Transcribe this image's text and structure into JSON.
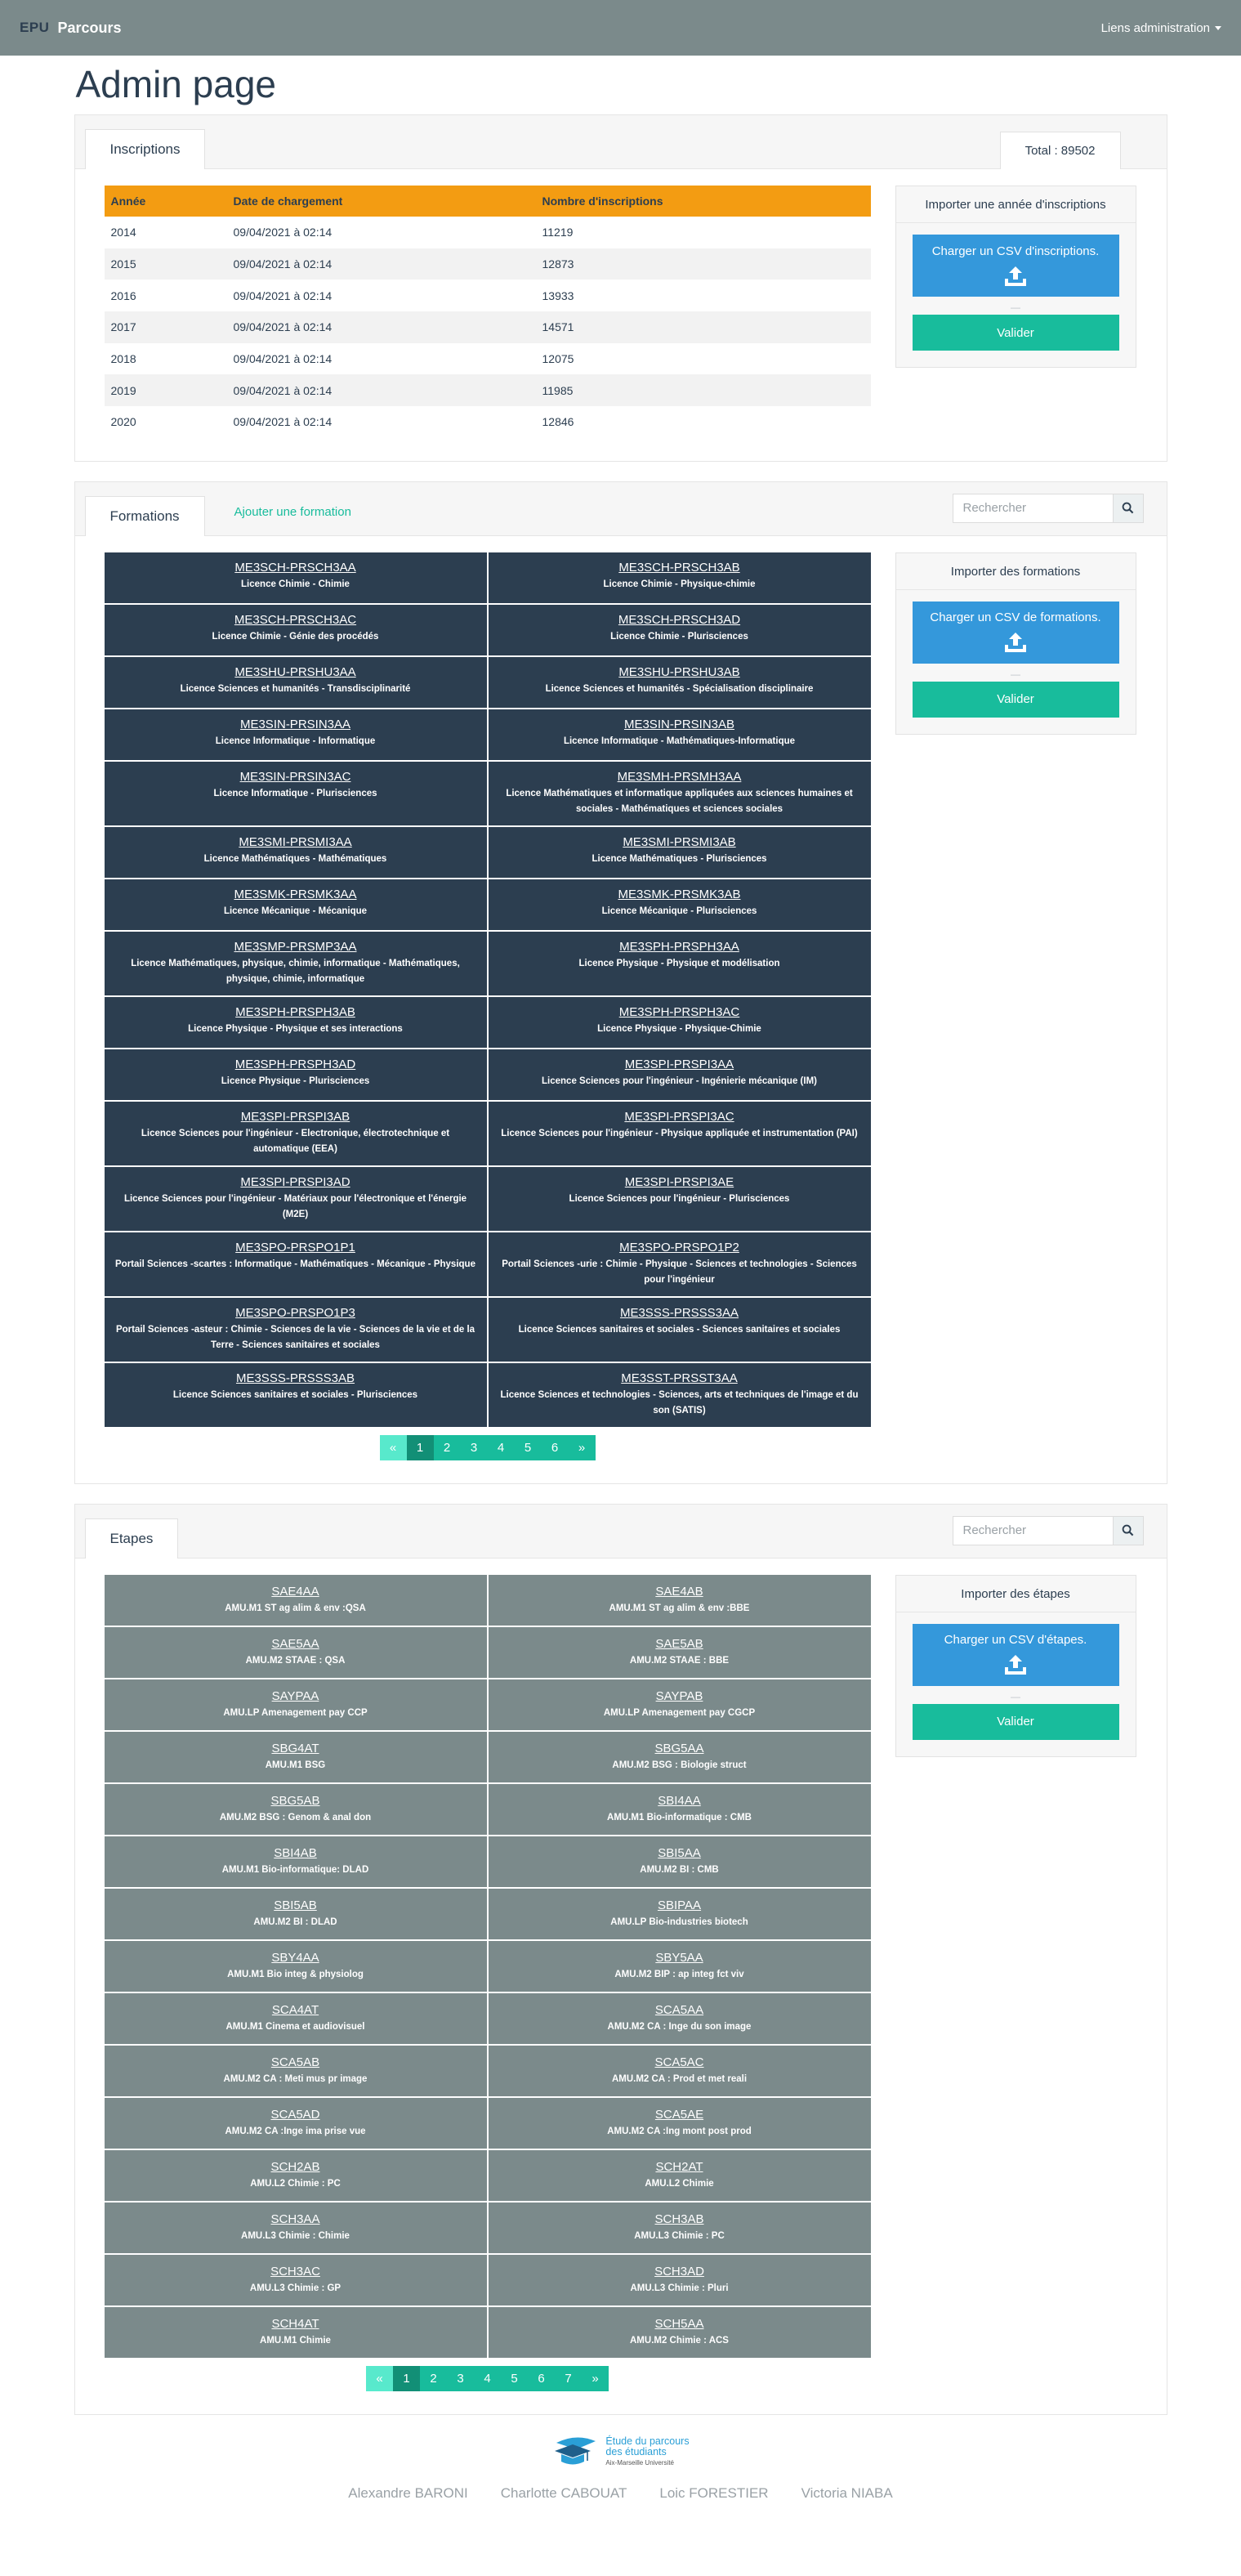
{
  "navbar": {
    "brand_short": "EPU",
    "brand_name": "Parcours",
    "admin_links": "Liens administration"
  },
  "page_title": "Admin page",
  "inscriptions": {
    "tab_label": "Inscriptions",
    "total_label": "Total : 89502",
    "columns": [
      "Année",
      "Date de chargement",
      "Nombre d'inscriptions"
    ],
    "rows": [
      [
        "2014",
        "09/04/2021 à 02:14",
        "11219"
      ],
      [
        "2015",
        "09/04/2021 à 02:14",
        "12873"
      ],
      [
        "2016",
        "09/04/2021 à 02:14",
        "13933"
      ],
      [
        "2017",
        "09/04/2021 à 02:14",
        "14571"
      ],
      [
        "2018",
        "09/04/2021 à 02:14",
        "12075"
      ],
      [
        "2019",
        "09/04/2021 à 02:14",
        "11985"
      ],
      [
        "2020",
        "09/04/2021 à 02:14",
        "12846"
      ]
    ],
    "import": {
      "title": "Importer une année d'inscriptions",
      "upload_label": "Charger un CSV d'inscriptions.",
      "separator": "—",
      "validate": "Valider"
    }
  },
  "formations": {
    "tab_label": "Formations",
    "add_link": "Ajouter une formation",
    "search_placeholder": "Rechercher",
    "items": [
      {
        "code": "ME3SCH-PRSCH3AA",
        "desc": "Licence Chimie - Chimie"
      },
      {
        "code": "ME3SCH-PRSCH3AB",
        "desc": "Licence Chimie - Physique-chimie"
      },
      {
        "code": "ME3SCH-PRSCH3AC",
        "desc": "Licence Chimie - Génie des procédés"
      },
      {
        "code": "ME3SCH-PRSCH3AD",
        "desc": "Licence Chimie - Plurisciences"
      },
      {
        "code": "ME3SHU-PRSHU3AA",
        "desc": "Licence Sciences et humanités - Transdisciplinarité"
      },
      {
        "code": "ME3SHU-PRSHU3AB",
        "desc": "Licence Sciences et humanités - Spécialisation disciplinaire"
      },
      {
        "code": "ME3SIN-PRSIN3AA",
        "desc": "Licence Informatique - Informatique"
      },
      {
        "code": "ME3SIN-PRSIN3AB",
        "desc": "Licence Informatique - Mathématiques-Informatique"
      },
      {
        "code": "ME3SIN-PRSIN3AC",
        "desc": "Licence Informatique - Plurisciences"
      },
      {
        "code": "ME3SMH-PRSMH3AA",
        "desc": "Licence Mathématiques et informatique appliquées aux sciences humaines et sociales - Mathématiques et sciences sociales"
      },
      {
        "code": "ME3SMI-PRSMI3AA",
        "desc": "Licence Mathématiques - Mathématiques"
      },
      {
        "code": "ME3SMI-PRSMI3AB",
        "desc": "Licence Mathématiques - Plurisciences"
      },
      {
        "code": "ME3SMK-PRSMK3AA",
        "desc": "Licence Mécanique - Mécanique"
      },
      {
        "code": "ME3SMK-PRSMK3AB",
        "desc": "Licence Mécanique - Plurisciences"
      },
      {
        "code": "ME3SMP-PRSMP3AA",
        "desc": "Licence Mathématiques, physique, chimie, informatique - Mathématiques, physique, chimie, informatique"
      },
      {
        "code": "ME3SPH-PRSPH3AA",
        "desc": "Licence Physique - Physique et modélisation"
      },
      {
        "code": "ME3SPH-PRSPH3AB",
        "desc": "Licence Physique - Physique et ses interactions"
      },
      {
        "code": "ME3SPH-PRSPH3AC",
        "desc": "Licence Physique - Physique-Chimie"
      },
      {
        "code": "ME3SPH-PRSPH3AD",
        "desc": "Licence Physique - Plurisciences"
      },
      {
        "code": "ME3SPI-PRSPI3AA",
        "desc": "Licence Sciences pour l'ingénieur - Ingénierie mécanique (IM)"
      },
      {
        "code": "ME3SPI-PRSPI3AB",
        "desc": "Licence Sciences pour l'ingénieur - Electronique, électrotechnique et automatique (EEA)"
      },
      {
        "code": "ME3SPI-PRSPI3AC",
        "desc": "Licence Sciences pour l'ingénieur - Physique appliquée et instrumentation (PAI)"
      },
      {
        "code": "ME3SPI-PRSPI3AD",
        "desc": "Licence Sciences pour l'ingénieur - Matériaux pour l'électronique et l'énergie (M2E)"
      },
      {
        "code": "ME3SPI-PRSPI3AE",
        "desc": "Licence Sciences pour l'ingénieur - Plurisciences"
      },
      {
        "code": "ME3SPO-PRSPO1P1",
        "desc": "Portail Sciences -scartes : Informatique - Mathématiques - Mécanique - Physique"
      },
      {
        "code": "ME3SPO-PRSPO1P2",
        "desc": "Portail Sciences -urie : Chimie - Physique - Sciences et technologies - Sciences pour l'ingénieur"
      },
      {
        "code": "ME3SPO-PRSPO1P3",
        "desc": "Portail Sciences -asteur : Chimie - Sciences de la vie - Sciences de la vie et de la Terre - Sciences sanitaires et sociales"
      },
      {
        "code": "ME3SSS-PRSSS3AA",
        "desc": "Licence Sciences sanitaires et sociales - Sciences sanitaires et sociales"
      },
      {
        "code": "ME3SSS-PRSSS3AB",
        "desc": "Licence Sciences sanitaires et sociales - Plurisciences"
      },
      {
        "code": "ME3SST-PRSST3AA",
        "desc": "Licence Sciences et technologies - Sciences, arts et techniques de l'image et du son (SATIS)"
      }
    ],
    "pagination": [
      "«",
      "1",
      "2",
      "3",
      "4",
      "5",
      "6",
      "»"
    ],
    "import": {
      "title": "Importer des formations",
      "upload_label": "Charger un CSV de formations.",
      "separator": "—",
      "validate": "Valider"
    }
  },
  "etapes": {
    "tab_label": "Etapes",
    "search_placeholder": "Rechercher",
    "items": [
      {
        "code": "SAE4AA",
        "desc": "AMU.M1 ST ag alim & env :QSA"
      },
      {
        "code": "SAE4AB",
        "desc": "AMU.M1 ST ag alim & env :BBE"
      },
      {
        "code": "SAE5AA",
        "desc": "AMU.M2 STAAE : QSA"
      },
      {
        "code": "SAE5AB",
        "desc": "AMU.M2 STAAE : BBE"
      },
      {
        "code": "SAYPAA",
        "desc": "AMU.LP Amenagement pay CCP"
      },
      {
        "code": "SAYPAB",
        "desc": "AMU.LP Amenagement pay CGCP"
      },
      {
        "code": "SBG4AT",
        "desc": "AMU.M1 BSG"
      },
      {
        "code": "SBG5AA",
        "desc": "AMU.M2 BSG : Biologie struct"
      },
      {
        "code": "SBG5AB",
        "desc": "AMU.M2 BSG : Genom & anal don"
      },
      {
        "code": "SBI4AA",
        "desc": "AMU.M1 Bio-informatique : CMB"
      },
      {
        "code": "SBI4AB",
        "desc": "AMU.M1 Bio-informatique: DLAD"
      },
      {
        "code": "SBI5AA",
        "desc": "AMU.M2 BI : CMB"
      },
      {
        "code": "SBI5AB",
        "desc": "AMU.M2 BI : DLAD"
      },
      {
        "code": "SBIPAA",
        "desc": "AMU.LP Bio-industries biotech"
      },
      {
        "code": "SBY4AA",
        "desc": "AMU.M1 Bio integ & physiolog"
      },
      {
        "code": "SBY5AA",
        "desc": "AMU.M2 BIP : ap integ fct viv"
      },
      {
        "code": "SCA4AT",
        "desc": "AMU.M1 Cinema et audiovisuel"
      },
      {
        "code": "SCA5AA",
        "desc": "AMU.M2 CA : Inge du son image"
      },
      {
        "code": "SCA5AB",
        "desc": "AMU.M2 CA : Meti mus pr image"
      },
      {
        "code": "SCA5AC",
        "desc": "AMU.M2 CA : Prod et met reali"
      },
      {
        "code": "SCA5AD",
        "desc": "AMU.M2 CA :Inge ima prise vue"
      },
      {
        "code": "SCA5AE",
        "desc": "AMU.M2 CA :Ing mont post prod"
      },
      {
        "code": "SCH2AB",
        "desc": "AMU.L2 Chimie : PC"
      },
      {
        "code": "SCH2AT",
        "desc": "AMU.L2 Chimie"
      },
      {
        "code": "SCH3AA",
        "desc": "AMU.L3 Chimie : Chimie"
      },
      {
        "code": "SCH3AB",
        "desc": "AMU.L3 Chimie : PC"
      },
      {
        "code": "SCH3AC",
        "desc": "AMU.L3 Chimie : GP"
      },
      {
        "code": "SCH3AD",
        "desc": "AMU.L3 Chimie : Pluri"
      },
      {
        "code": "SCH4AT",
        "desc": "AMU.M1 Chimie"
      },
      {
        "code": "SCH5AA",
        "desc": "AMU.M2 Chimie : ACS"
      }
    ],
    "pagination": [
      "«",
      "1",
      "2",
      "3",
      "4",
      "5",
      "6",
      "7",
      "»"
    ],
    "import": {
      "title": "Importer des étapes",
      "upload_label": "Charger un CSV d'étapes.",
      "separator": "—",
      "validate": "Valider"
    }
  },
  "footer": {
    "logo_line1": "Étude du parcours",
    "logo_line2": "des étudiants",
    "logo_line3": "Aix-Marseille Université",
    "authors": [
      "Alexandre BARONI",
      "Charlotte CABOUAT",
      "Loic FORESTIER",
      "Victoria NIABA"
    ]
  },
  "colors": {
    "navbar": "#7b8a8b",
    "primary": "#2c3e50",
    "accent": "#18bc9c",
    "info": "#3498db",
    "warning": "#f39c12",
    "secondary": "#7b8a8b"
  }
}
